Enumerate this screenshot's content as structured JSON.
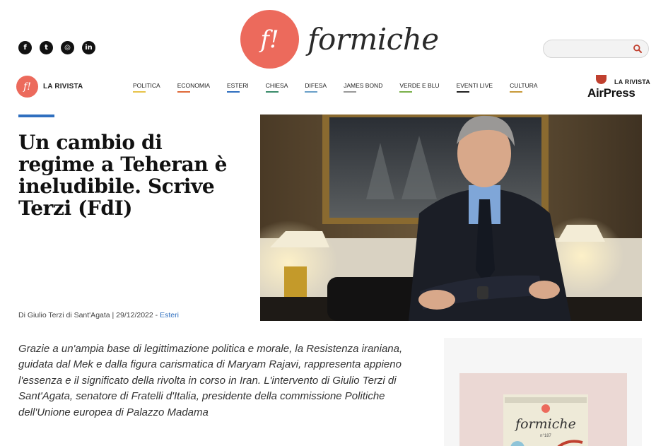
{
  "social": [
    {
      "name": "facebook-icon",
      "glyph": "f"
    },
    {
      "name": "twitter-icon",
      "glyph": "t"
    },
    {
      "name": "instagram-icon",
      "glyph": "◎"
    },
    {
      "name": "linkedin-icon",
      "glyph": "in"
    }
  ],
  "logo": {
    "mark": "f!",
    "word": "formiche"
  },
  "search": {
    "placeholder": ""
  },
  "rivista": {
    "mark": "f!",
    "label": "LA RIVISTA"
  },
  "nav": [
    {
      "label": "POLITICA",
      "color": "#e7c34a"
    },
    {
      "label": "ECONOMIA",
      "color": "#e06a3a"
    },
    {
      "label": "ESTERI",
      "color": "#2f6fbf"
    },
    {
      "label": "CHIESA",
      "color": "#3a8c6a"
    },
    {
      "label": "DIFESA",
      "color": "#6aa0c8"
    },
    {
      "label": "JAMES BOND",
      "color": "#999999"
    },
    {
      "label": "VERDE E BLU",
      "color": "#7ab04a"
    },
    {
      "label": "EVENTI LIVE",
      "color": "#222222"
    },
    {
      "label": "CULTURA",
      "color": "#c89a3a"
    }
  ],
  "airpress": {
    "top": "LA RIVISTA",
    "bottom": "AirPress"
  },
  "article": {
    "headline": "Un cambio di regime a Teheran è ineludibile. Scrive Terzi (FdI)",
    "byline_prefix": "Di Giulio Terzi di Sant'Agata | 29/12/2022 - ",
    "category": "Esteri",
    "lead": "Grazie a un'ampia base di legittimazione politica e morale, la Resistenza iraniana,  guidata dal Mek e dalla figura carismatica di Maryam Rajavi, rappresenta appieno l'essenza e il significato della rivolta in corso in Iran. L'intervento di Giulio Terzi di Sant'Agata, senatore di Fratelli d'Italia, presidente della commissione Politiche dell'Unione europea di Palazzo Madama"
  },
  "magazine": {
    "title": "formiche",
    "issue": "n°187"
  }
}
